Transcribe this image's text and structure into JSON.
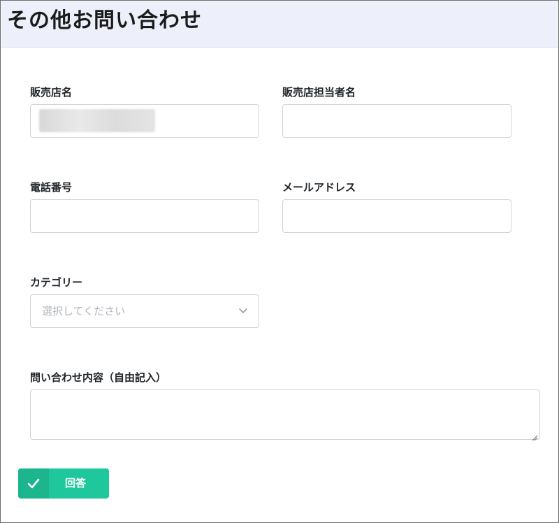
{
  "page": {
    "title": "その他お問い合わせ"
  },
  "form": {
    "store_name": {
      "label": "販売店名",
      "value": ""
    },
    "store_contact": {
      "label": "販売店担当者名",
      "value": ""
    },
    "phone": {
      "label": "電話番号",
      "value": ""
    },
    "email": {
      "label": "メールアドレス",
      "value": ""
    },
    "category": {
      "label": "カテゴリー",
      "placeholder": "選択してください"
    },
    "inquiry": {
      "label": "問い合わせ内容（自由記入）",
      "value": ""
    }
  },
  "submit": {
    "label": "回答",
    "icon": "check-icon"
  },
  "colors": {
    "header_bg": "#edf0fb",
    "button": "#1fc79c",
    "button_icon_bg": "#1cb58e",
    "input_border": "#ced4da"
  }
}
